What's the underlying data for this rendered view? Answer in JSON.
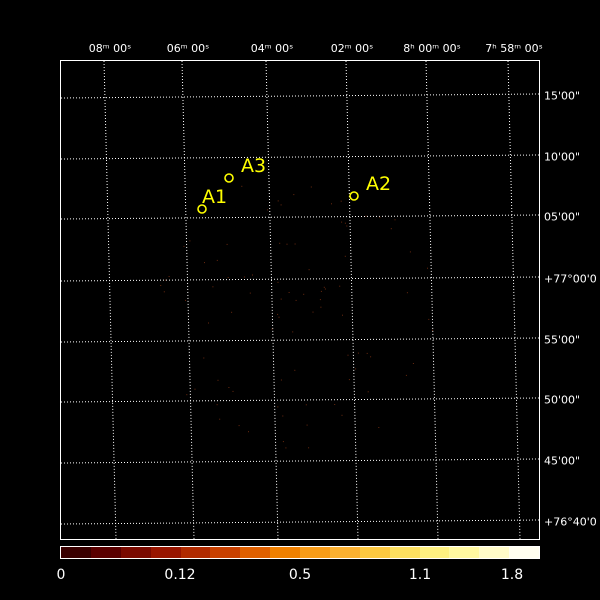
{
  "ra_ticks": [
    {
      "label": "08ᵐ 00ˢ"
    },
    {
      "label": "06ᵐ 00ˢ"
    },
    {
      "label": "04ᵐ 00ˢ"
    },
    {
      "label": "02ᵐ 00ˢ"
    },
    {
      "label": "8ʰ 00ᵐ 00ˢ"
    },
    {
      "label": "7ʰ 58ᵐ 00ˢ"
    }
  ],
  "dec_ticks": [
    {
      "label": "15'00\""
    },
    {
      "label": "10'00\""
    },
    {
      "label": "05'00\""
    },
    {
      "label": "+77°00'0"
    },
    {
      "label": "55'00\""
    },
    {
      "label": "50'00\""
    },
    {
      "label": "45'00\""
    },
    {
      "label": "+76°40'0"
    }
  ],
  "sources": [
    {
      "name": "A1"
    },
    {
      "name": "A2"
    },
    {
      "name": "A3"
    }
  ],
  "colorbar": {
    "tick_labels": [
      "0",
      "0.12",
      "0.5",
      "1.1",
      "1.8"
    ],
    "colors": [
      "#3a0000",
      "#5a0000",
      "#7a0a00",
      "#981500",
      "#b02a00",
      "#c84000",
      "#e06000",
      "#f08000",
      "#f89c18",
      "#fbb030",
      "#fcc840",
      "#fde060",
      "#fef080",
      "#fff8a0",
      "#fffbc8",
      "#fffef0"
    ]
  },
  "grid_color": "#ffffff",
  "source_color": "#ffff00"
}
